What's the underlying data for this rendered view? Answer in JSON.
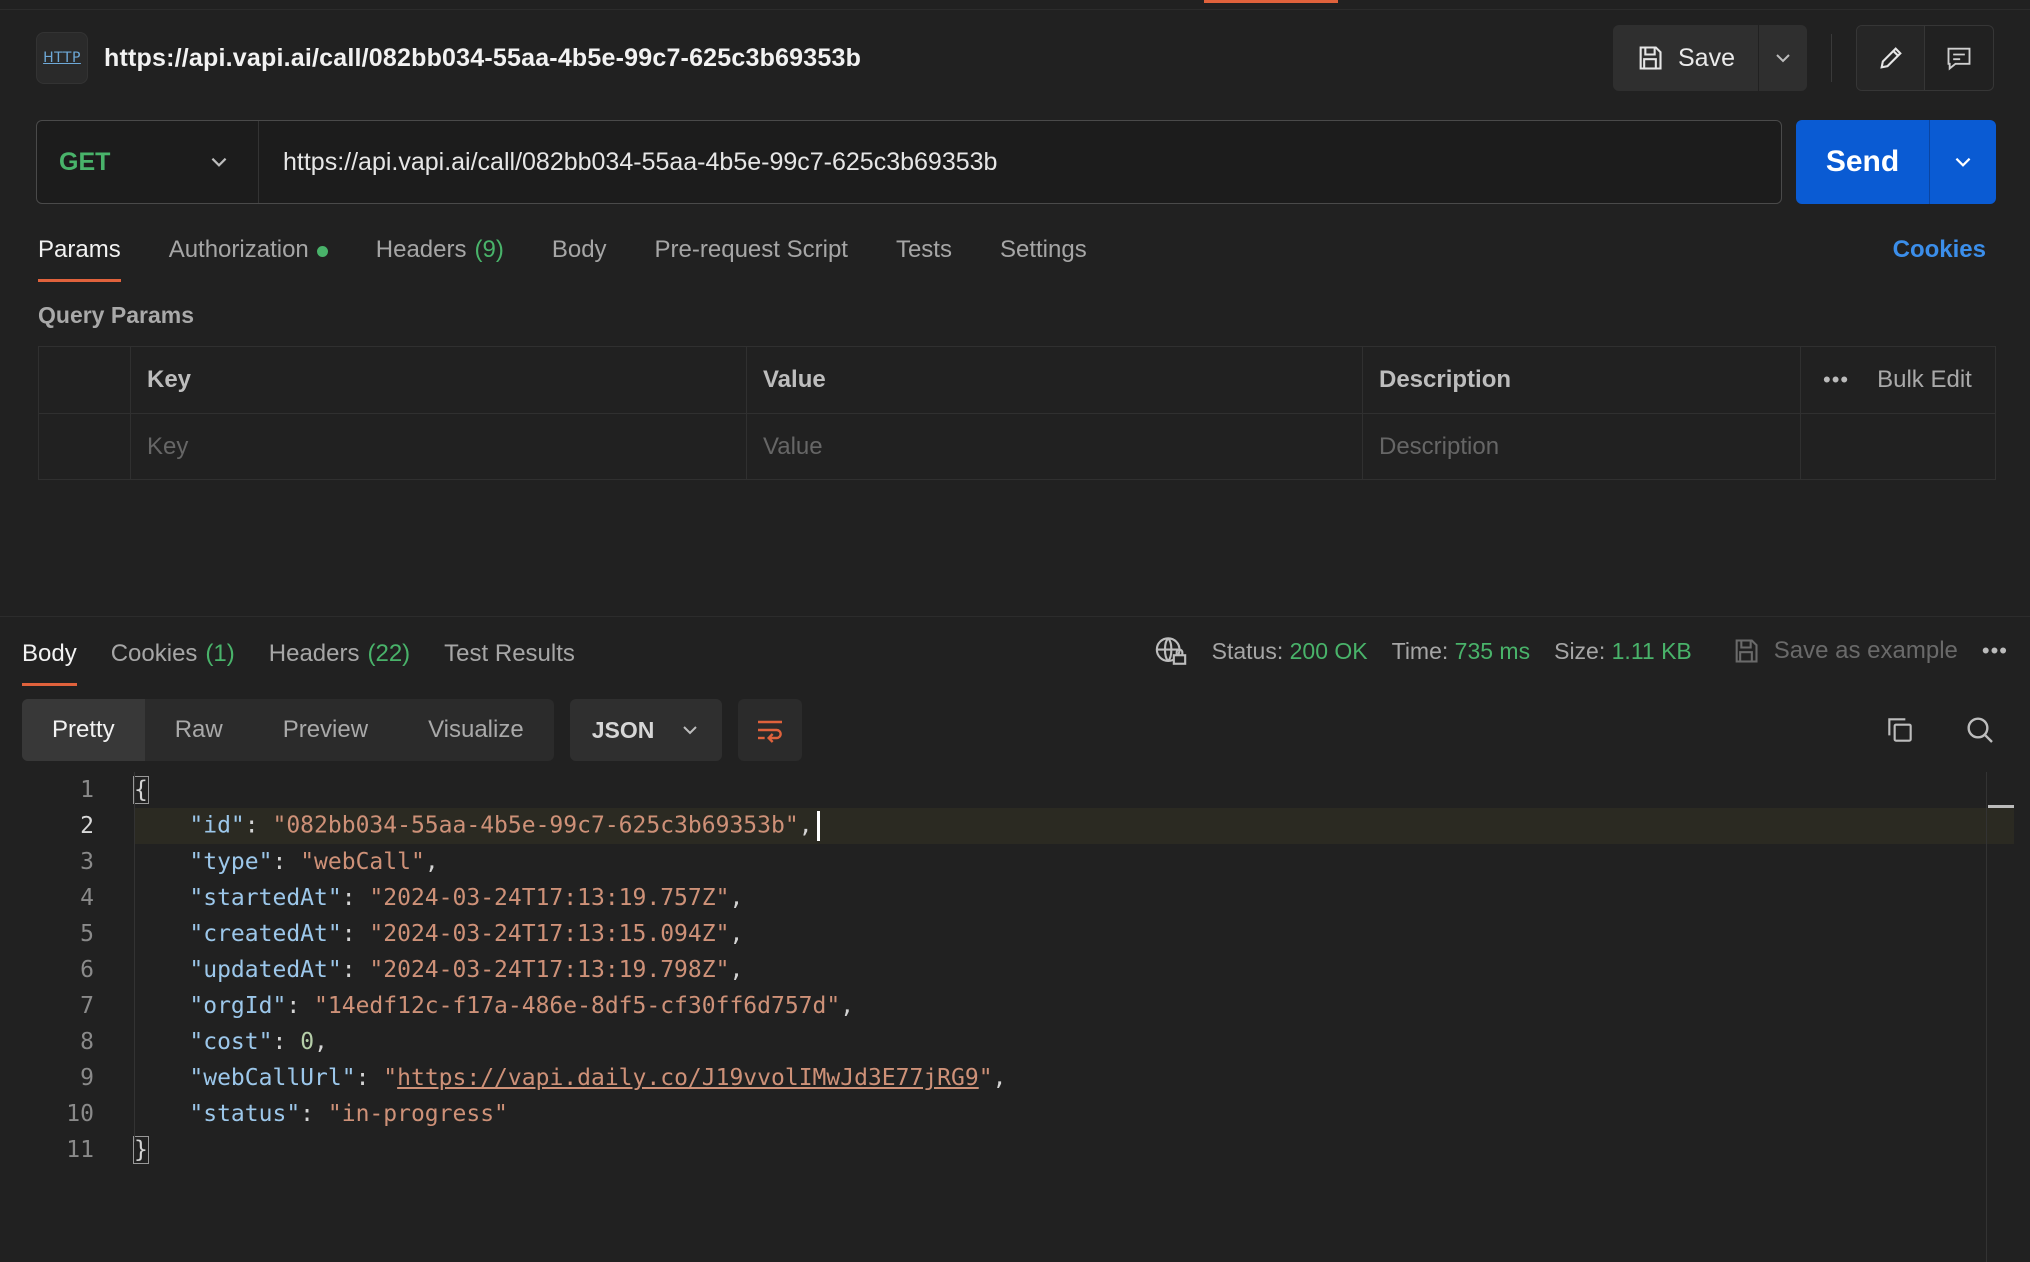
{
  "request": {
    "badge": "HTTP",
    "title": "https://api.vapi.ai/call/082bb034-55aa-4b5e-99c7-625c3b69353b",
    "save_label": "Save",
    "method": "GET",
    "url": "https://api.vapi.ai/call/082bb034-55aa-4b5e-99c7-625c3b69353b",
    "send_label": "Send"
  },
  "request_tabs": {
    "params": "Params",
    "authorization": "Authorization",
    "headers": "Headers",
    "headers_count": "(9)",
    "body": "Body",
    "pre_request": "Pre-request Script",
    "tests": "Tests",
    "settings": "Settings",
    "cookies": "Cookies"
  },
  "query_params": {
    "label": "Query Params",
    "columns": {
      "key": "Key",
      "value": "Value",
      "description": "Description"
    },
    "bulk_edit": "Bulk Edit",
    "placeholders": {
      "key": "Key",
      "value": "Value",
      "description": "Description"
    }
  },
  "response_tabs": {
    "body": "Body",
    "cookies": "Cookies",
    "cookies_count": "(1)",
    "headers": "Headers",
    "headers_count": "(22)",
    "test_results": "Test Results"
  },
  "response_meta": {
    "status_label": "Status:",
    "status_value": "200 OK",
    "time_label": "Time:",
    "time_value": "735 ms",
    "size_label": "Size:",
    "size_value": "1.11 KB",
    "save_example": "Save as example"
  },
  "view_modes": {
    "pretty": "Pretty",
    "raw": "Raw",
    "preview": "Preview",
    "visualize": "Visualize",
    "format": "JSON"
  },
  "response_body": {
    "line_numbers": [
      "1",
      "2",
      "3",
      "4",
      "5",
      "6",
      "7",
      "8",
      "9",
      "10",
      "11"
    ],
    "open_brace": "{",
    "close_brace": "}",
    "fields": [
      {
        "key": "\"id\"",
        "value": "\"082bb034-55aa-4b5e-99c7-625c3b69353b\""
      },
      {
        "key": "\"type\"",
        "value": "\"webCall\""
      },
      {
        "key": "\"startedAt\"",
        "value": "\"2024-03-24T17:13:19.757Z\""
      },
      {
        "key": "\"createdAt\"",
        "value": "\"2024-03-24T17:13:15.094Z\""
      },
      {
        "key": "\"updatedAt\"",
        "value": "\"2024-03-24T17:13:19.798Z\""
      },
      {
        "key": "\"orgId\"",
        "value": "\"14edf12c-f17a-486e-8df5-cf30ff6d757d\""
      },
      {
        "key": "\"cost\"",
        "value": "0"
      },
      {
        "key": "\"webCallUrl\"",
        "value": "https://vapi.daily.co/J19vvolIMwJd3E77jRG9"
      },
      {
        "key": "\"status\"",
        "value": "\"in-progress\""
      }
    ]
  },
  "colors": {
    "accent_orange": "#e0623c",
    "send_blue": "#0a5bd3",
    "get_green": "#49b36a",
    "link_blue": "#3b8eea"
  }
}
